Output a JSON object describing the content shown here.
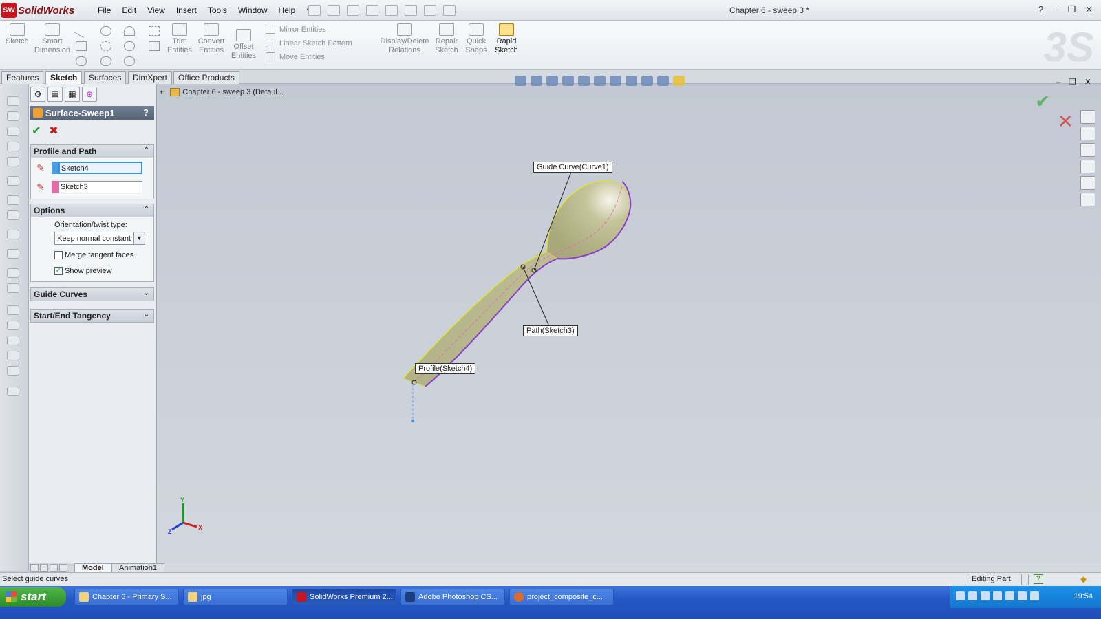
{
  "app": {
    "name": "SolidWorks",
    "document_title": "Chapter 6 - sweep 3 *"
  },
  "menu": [
    "File",
    "Edit",
    "View",
    "Insert",
    "Tools",
    "Window",
    "Help"
  ],
  "commands": {
    "sketch": "Sketch",
    "smart_dimension": "Smart Dimension",
    "trim": "Trim Entities",
    "convert": "Convert Entities",
    "offset": "Offset Entities",
    "mirror": "Mirror Entities",
    "linear_pattern": "Linear Sketch Pattern",
    "move": "Move Entities",
    "display_relations": "Display/Delete Relations",
    "repair": "Repair Sketch",
    "quick_snaps": "Quick Snaps",
    "rapid_sketch": "Rapid Sketch"
  },
  "tabs": [
    "Features",
    "Sketch",
    "Surfaces",
    "DimXpert",
    "Office Products"
  ],
  "property_manager": {
    "title": "Surface-Sweep1",
    "help": "?",
    "profile_path": {
      "heading": "Profile and Path",
      "profile_value": "Sketch4",
      "path_value": "Sketch3",
      "profile_color": "#4a9ee6",
      "path_color": "#e86aa8"
    },
    "options": {
      "heading": "Options",
      "orientation_label": "Orientation/twist type:",
      "orientation_value": "Keep normal constant",
      "merge_label": "Merge tangent faces",
      "merge_checked": false,
      "preview_label": "Show preview",
      "preview_checked": true
    },
    "guide_curves": "Guide Curves",
    "tangency": "Start/End Tangency"
  },
  "graphics": {
    "tree_text": "Chapter 6 - sweep 3  (Defaul...",
    "callouts": {
      "guide": "Guide Curve(Curve1)",
      "path": "Path(Sketch3)",
      "profile": "Profile(Sketch4)"
    },
    "axes": {
      "x": "X",
      "y": "Y",
      "z": "Z"
    }
  },
  "bottom_tabs": [
    "Model",
    "Animation1"
  ],
  "status": {
    "message": "Select guide curves",
    "mode": "Editing Part"
  },
  "taskbar": {
    "start": "start",
    "tasks": [
      "Chapter 6 - Primary S...",
      "jpg",
      "SolidWorks Premium 2...",
      "Adobe Photoshop CS...",
      "project_composite_c..."
    ],
    "clock": "19:54"
  }
}
